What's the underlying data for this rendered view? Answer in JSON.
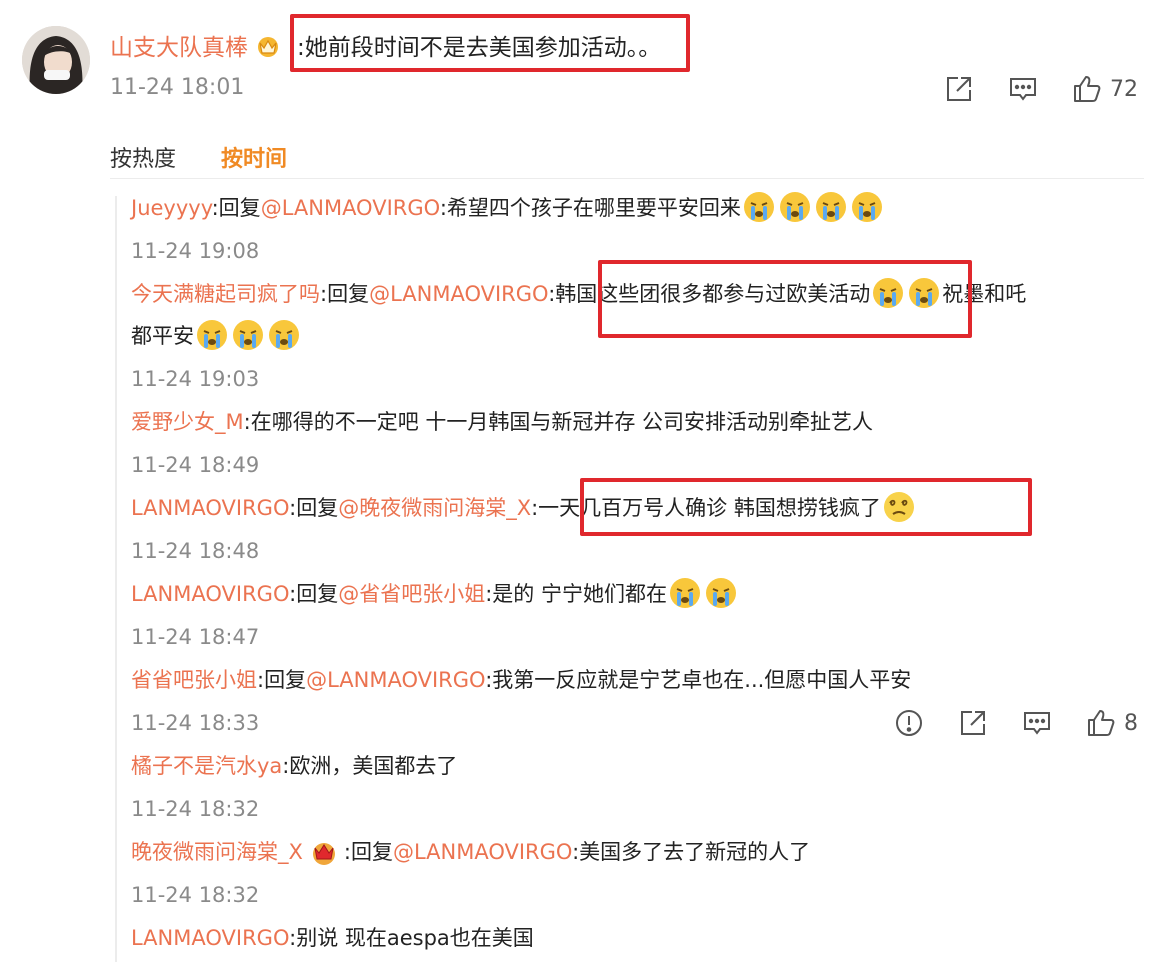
{
  "top_comment": {
    "user": "山支大队真棒",
    "text": ":她前段时间不是去美国参加活动。。",
    "time": "11-24 18:01",
    "like_count": "72"
  },
  "sort": {
    "hot": "按热度",
    "time": "按时间"
  },
  "replies": [
    {
      "user": "Jueyyyy",
      "sep": ":回复",
      "mention": "@LANMAOVIRGO",
      "text": ":希望四个孩子在哪里要平安回来",
      "time": "11-24 19:08"
    },
    {
      "user": "今天满糖起司疯了吗",
      "sep": ":回复",
      "mention": "@LANMAOVIRGO",
      "text": ":韩国这些团很多都参与过欧美活动",
      "text2": "祝墨和吒",
      "line2": "都平安",
      "time": "11-24 19:03"
    },
    {
      "user": "爱野少女_M",
      "text": ":在哪得的不一定吧 十一月韩国与新冠并存 公司安排活动别牵扯艺人",
      "time": "11-24 18:49"
    },
    {
      "user": "LANMAOVIRGO",
      "sep": ":回复",
      "mention": "@晚夜微雨问海棠_X",
      "text": ":一天几百万号人确诊 韩国想捞钱疯了",
      "time": "11-24 18:48"
    },
    {
      "user": "LANMAOVIRGO",
      "sep": ":回复",
      "mention": "@省省吧张小姐",
      "text": ":是的 宁宁她们都在",
      "time": "11-24 18:47"
    },
    {
      "user": "省省吧张小姐",
      "sep": ":回复",
      "mention": "@LANMAOVIRGO",
      "text": ":我第一反应就是宁艺卓也在...但愿中国人平安",
      "time": "11-24 18:33",
      "like_count": "8"
    },
    {
      "user": "橘子不是汽水ya",
      "text": ":欧洲，美国都去了",
      "time": "11-24 18:32"
    },
    {
      "user": "晚夜微雨问海棠_X",
      "sep": ":回复",
      "mention": "@LANMAOVIRGO",
      "text": ":美国多了去了新冠的人了",
      "time": "11-24 18:32"
    },
    {
      "user": "LANMAOVIRGO",
      "text": ":别说 现在aespa也在美国"
    }
  ],
  "colors": {
    "username": "#eb7350",
    "sort_active": "#f08a24",
    "highlight": "#e0282d",
    "timestamp": "#8a8a8a"
  }
}
